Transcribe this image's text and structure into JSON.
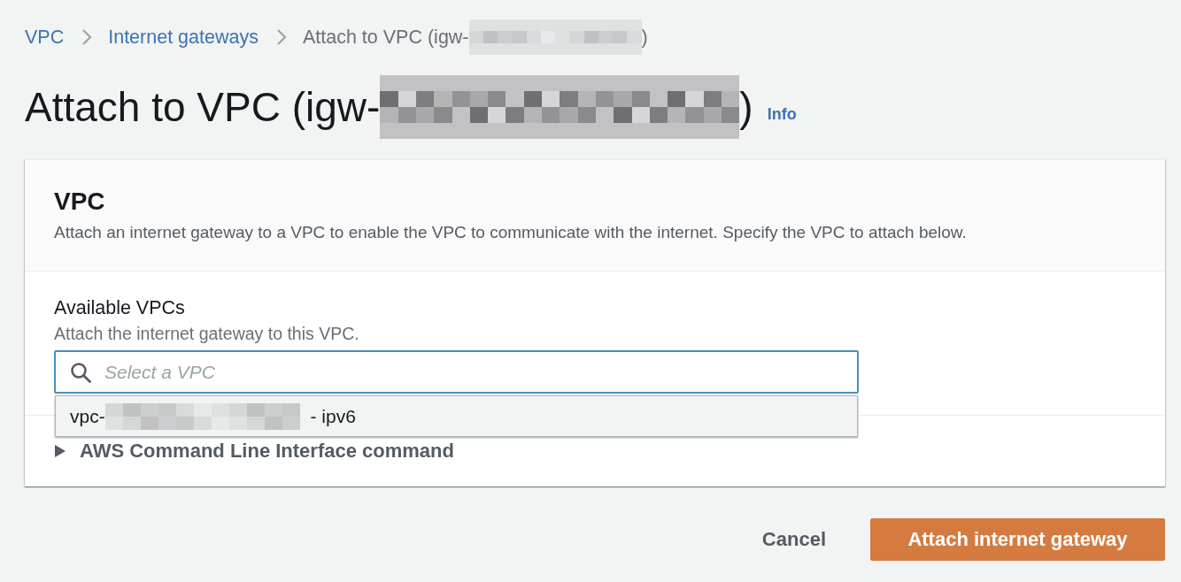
{
  "breadcrumbs": [
    {
      "kind": "link",
      "segments": [
        {
          "kind": "text",
          "text": "VPC"
        }
      ]
    },
    {
      "kind": "link",
      "segments": [
        {
          "kind": "text",
          "text": "Internet gateways"
        }
      ]
    },
    {
      "kind": "current",
      "segments": [
        {
          "kind": "text",
          "text": "Attach to VPC (igw-"
        },
        {
          "kind": "redacted"
        },
        {
          "kind": "text",
          "text": ")"
        }
      ]
    }
  ],
  "page_title": {
    "segments": [
      {
        "kind": "text",
        "text": "Attach to VPC (igw-"
      },
      {
        "kind": "redacted"
      },
      {
        "kind": "text",
        "text": ")"
      }
    ],
    "info_link": "Info"
  },
  "panel": {
    "title": "VPC",
    "description": "Attach an internet gateway to a VPC to enable the VPC to communicate with the internet. Specify the VPC to attach below."
  },
  "vpc_field": {
    "label": "Available VPCs",
    "hint": "Attach the internet gateway to this VPC.",
    "placeholder": "Select a VPC",
    "expanded": true,
    "options": [
      {
        "segments": [
          {
            "kind": "text",
            "text": "vpc-"
          },
          {
            "kind": "redacted"
          },
          {
            "kind": "text",
            "text": " - ipv6"
          }
        ],
        "highlighted": true
      }
    ]
  },
  "cli_section": {
    "label": "AWS Command Line Interface command",
    "expanded": false
  },
  "actions": [
    {
      "kind": "link",
      "label": "Cancel"
    },
    {
      "kind": "primary",
      "label": "Attach internet gateway"
    }
  ]
}
